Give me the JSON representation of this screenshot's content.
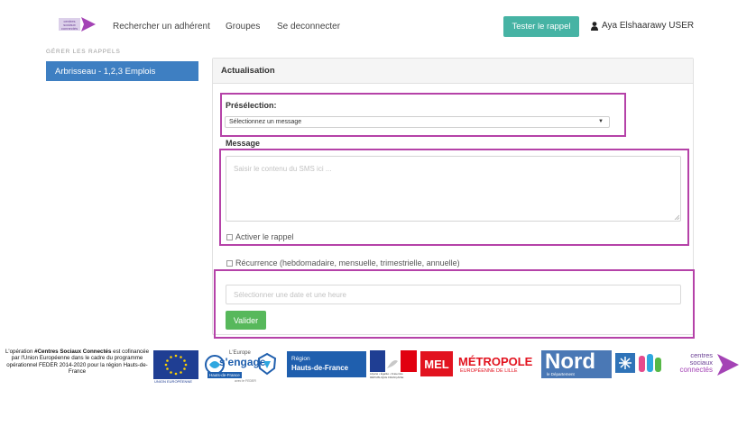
{
  "header": {
    "logo_text": [
      "centres",
      "sociaux",
      "connectés"
    ],
    "nav": [
      "Rechercher un adhérent",
      "Groupes",
      "Se deconnecter"
    ],
    "test_button": "Tester le rappel",
    "user": "Aya Elshaarawy USER"
  },
  "sidebar": {
    "title": "GÉRER LES RAPPELS",
    "items": [
      {
        "label": "Arbrisseau - 1,2,3 Emplois"
      }
    ]
  },
  "panel": {
    "title": "Actualisation",
    "preselection_label": "Présélection:",
    "preselection_value": "Sélectionnez un message",
    "message_label": "Message",
    "message_placeholder": "Saisir le contenu du SMS ici ...",
    "activer_label": "Activer le rappel",
    "recurrence_label": "Récurrence (hebdomadaire, mensuelle, trimestrielle, annuelle)",
    "date_placeholder": "Sélectionner une date et une heure",
    "submit_label": "Valider"
  },
  "footer": {
    "legal_bold": "#Centres Sociaux Connectés",
    "legal_prefix": "L'opération ",
    "legal_rest": " est cofinancée par l'Union Européenne dans le cadre du programme opérationnel FEDER 2014-2020 pour la région Hauts-de-France",
    "eu_caption": "UNION EUROPÉENNE",
    "engage_top": "L'Europe",
    "engage_main": "s'engage",
    "engage_sub": "Hauts-de-France",
    "engage_small": "avec le FEDER",
    "region_line1": "Région",
    "region_line2": "Hauts-de-France",
    "republique": "Liberté • Égalité • Fraternité RÉPUBLIQUE FRANÇAISE",
    "mel": "MEL",
    "metropole": "MÉTROPOLE",
    "metropole_sub": "EUROPÉENNE DE LILLE",
    "nord": "Nord",
    "nord_sub": "le Département",
    "csc": [
      "centres",
      "sociaux",
      "connectés"
    ]
  },
  "colors": {
    "accent_teal": "#46b3a4",
    "sidebar_blue": "#3e7fc2",
    "valider_green": "#57b85b",
    "highlight_magenta": "#b542a8",
    "brand_purple": "#a443b5"
  }
}
